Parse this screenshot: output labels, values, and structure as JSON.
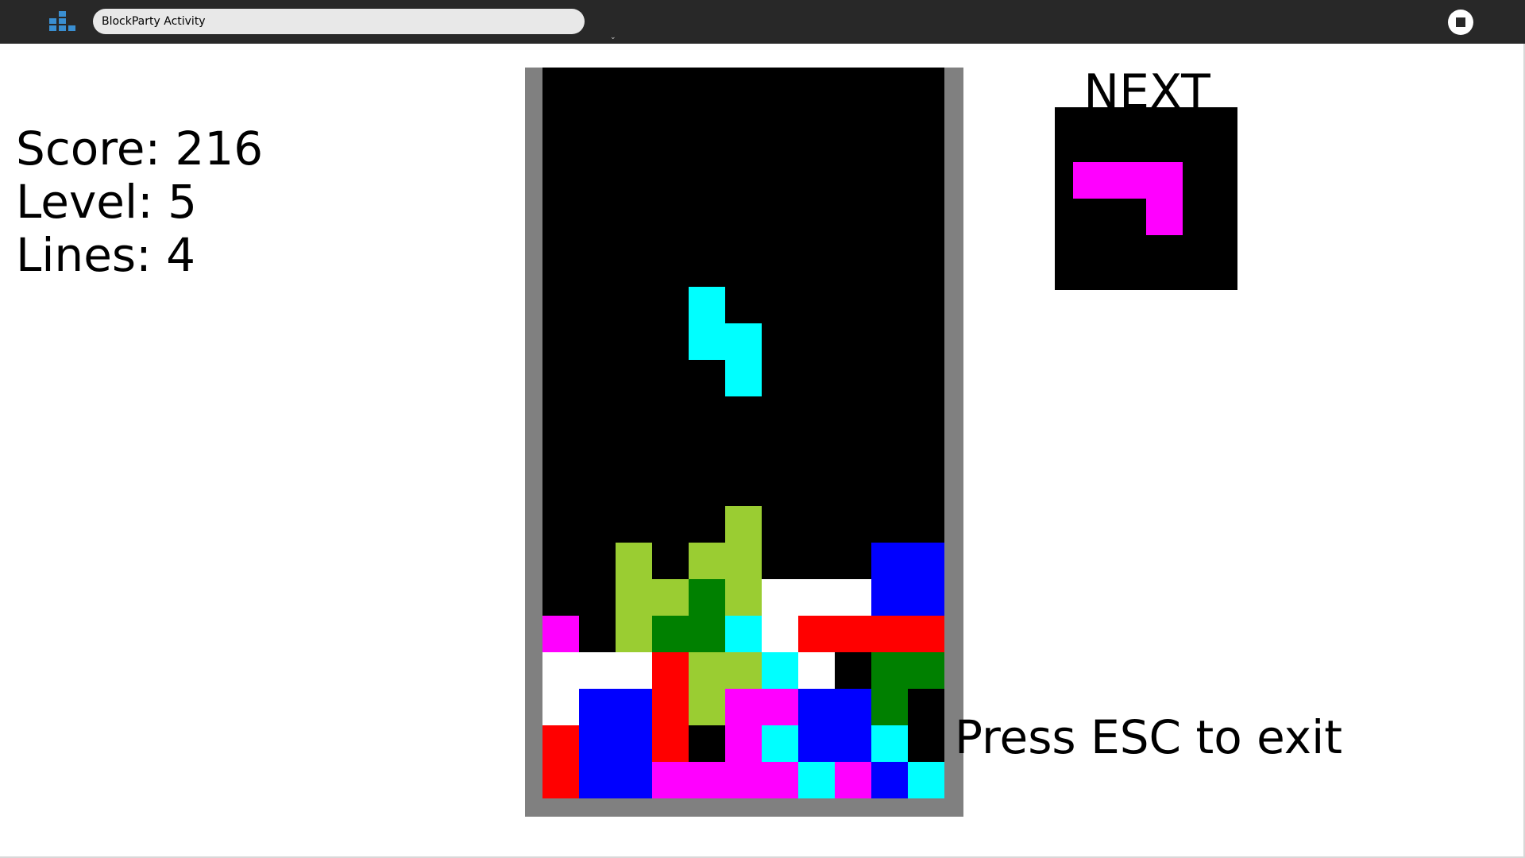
{
  "toolbar": {
    "activity_icon": "blockparty-activity-icon",
    "title": "BlockParty Activity",
    "stop_icon": "stop-icon"
  },
  "stats": {
    "score": "Score: 216",
    "level": "Level: 5",
    "lines": "Lines: 4"
  },
  "next_label": "NEXT",
  "exit_hint": "Press ESC to exit",
  "colors": {
    "B": "#0000ff",
    "R": "#ff0000",
    "W": "#ffffff",
    "M": "#ff00ff",
    "C": "#00ffff",
    "L": "#9acd32",
    "G": "#008000",
    "well": "#808080"
  },
  "board": {
    "columns": 11,
    "rows": [
      "...........",
      "...........",
      "...........",
      "...........",
      "...........",
      "...........",
      "....C......",
      "....CC.....",
      ".....C.....",
      "...........",
      "...........",
      "...........",
      ".....L.....",
      "..L.LL...BB",
      "..LLGLWWWBB",
      "M.LGGCWRRRR",
      "WWWRLLCW.GG",
      "WBBRLMMBBG.",
      "RBBR.MCBBC.",
      "RBBMMMMCMBC"
    ]
  },
  "next_piece": {
    "rows": [
      "....",
      "MMM.",
      "..M.",
      "...."
    ]
  }
}
